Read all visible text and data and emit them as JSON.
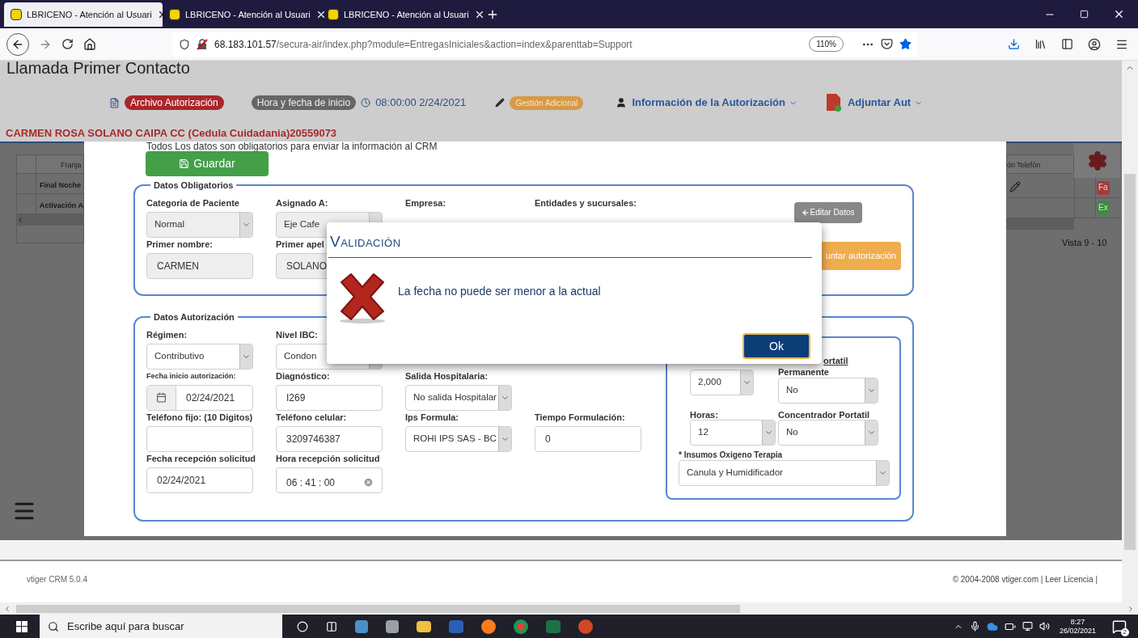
{
  "browser": {
    "tabs": [
      {
        "title": "LBRICENO - Atención al Usuari",
        "selected": true
      },
      {
        "title": "LBRICENO - Atención al Usuari",
        "selected": false
      },
      {
        "title": "LBRICENO - Atención al Usuari",
        "selected": false
      }
    ],
    "url_host": "68.183.101.57",
    "url_path": "/secura-air/index.php?module=EntregasIniciales&action=index&parenttab=Support",
    "zoom": "110%"
  },
  "page": {
    "title": "Llamada Primer Contacto",
    "toolbar": {
      "file_badge": "Archivo Autorización",
      "start_label": "Hora y fecha de inicio",
      "start_time": "08:00:00 2/24/2021",
      "extra_badge": "Gestión Adicional",
      "info_menu": "Información de la Autorización",
      "attach_menu": "Adjuntar Aut"
    },
    "patient": "CARMEN ROSA SOLANO CAIPA CC (Cedula Cuidadania)20559073"
  },
  "background": {
    "left_table": {
      "column": "Franja",
      "rows": [
        "Final Noche",
        "Activación A"
      ]
    },
    "right_table": {
      "column": "ón Telefón",
      "badges": [
        {
          "text": "Fa",
          "color": "#a83a36"
        },
        {
          "text": "Ex",
          "color": "#3f8a3f"
        }
      ],
      "pager": "Vista 9 - 10"
    }
  },
  "form": {
    "notice": "Todos Los datos son obligatorios para enviar la información al CRM",
    "save": "Guardar",
    "obligatorios": {
      "legend": "Datos Obligatorios",
      "rows": [
        [
          {
            "label": "Categoria de Paciente",
            "kind": "select",
            "value": "Normal",
            "disabled": true
          },
          {
            "label": "Asignado A:",
            "kind": "select",
            "value": "Eje Cafe",
            "disabled": true
          },
          {
            "label": "Empresa:"
          },
          {
            "label": "Entidades y sucursales:"
          }
        ],
        [
          {
            "label": "Primer nombre:",
            "kind": "input",
            "value": "CARMEN",
            "disabled": true
          },
          {
            "label": "Primer apel",
            "kind": "input",
            "value": "SOLANO",
            "disabled": true
          }
        ]
      ],
      "edit_button": "Editar Datos",
      "attach_button": "untar autorización"
    },
    "autorizacion": {
      "legend": "Datos Autorización",
      "rows": [
        [
          {
            "label": "Régimen:",
            "kind": "select",
            "value": "Contributivo",
            "disabled": false
          },
          {
            "label": "Nivel IBC:",
            "kind": "select",
            "value": "Condon",
            "disabled": false
          }
        ],
        [
          {
            "label": "Fecha inicio autorización:",
            "small": true,
            "kind": "date",
            "value": "02/24/2021",
            "disabled": false
          },
          {
            "label": "Diagnóstico:",
            "kind": "input",
            "value": "I269",
            "disabled": false
          },
          {
            "label": "Salida Hospitalaria:",
            "kind": "select",
            "value": "No salida Hospitalar",
            "disabled": false
          }
        ],
        [
          {
            "label": "Teléfono fijo: (10 Digitos)",
            "kind": "input",
            "disabled": false
          },
          {
            "label": "Teléfono celular:",
            "kind": "input",
            "value": "3209746387",
            "disabled": false
          },
          {
            "label": "Ips Formula:",
            "kind": "select",
            "value": "ROHI IPS SAS - BC",
            "disabled": false
          },
          {
            "label": "Tiempo Formulación:",
            "kind": "input",
            "value": "0",
            "disabled": false
          }
        ],
        [
          {
            "label": "Fecha recepción solicitud",
            "kind": "input",
            "value": "02/24/2021",
            "disabled": false
          },
          {
            "label": "Hora recepción solicitud",
            "kind": "time",
            "value": "06 : 41 : 00",
            "disabled": false
          }
        ]
      ],
      "consumo": {
        "cylinder": "ortatil",
        "liters": {
          "kind": "select",
          "value": "2,000",
          "disabled": false
        },
        "permanent": {
          "label": "Permanente",
          "kind": "select",
          "value": "No",
          "disabled": false
        },
        "hours": {
          "label": "Horas:",
          "kind": "select",
          "value": "12",
          "disabled": false
        },
        "concentrator": {
          "label": "Concentrador Portatil",
          "kind": "select",
          "value": "No",
          "disabled": false
        },
        "supplies": {
          "label": "* Insumos Oxigeno Terapia",
          "kind": "select",
          "value": "Canula y Humidificador",
          "disabled": false
        }
      }
    }
  },
  "dialog": {
    "title": "Validación",
    "message": "La fecha no puede ser menor a la actual",
    "ok": "Ok"
  },
  "footer": {
    "version": "vtiger CRM 5.0.4",
    "copyright": "© 2004-2008 vtiger.com | Leer Licencia |"
  },
  "taskbar": {
    "search_placeholder": "Escribe aquí para buscar",
    "time": "8:27",
    "date": "26/02/2021",
    "notifications": "2"
  }
}
